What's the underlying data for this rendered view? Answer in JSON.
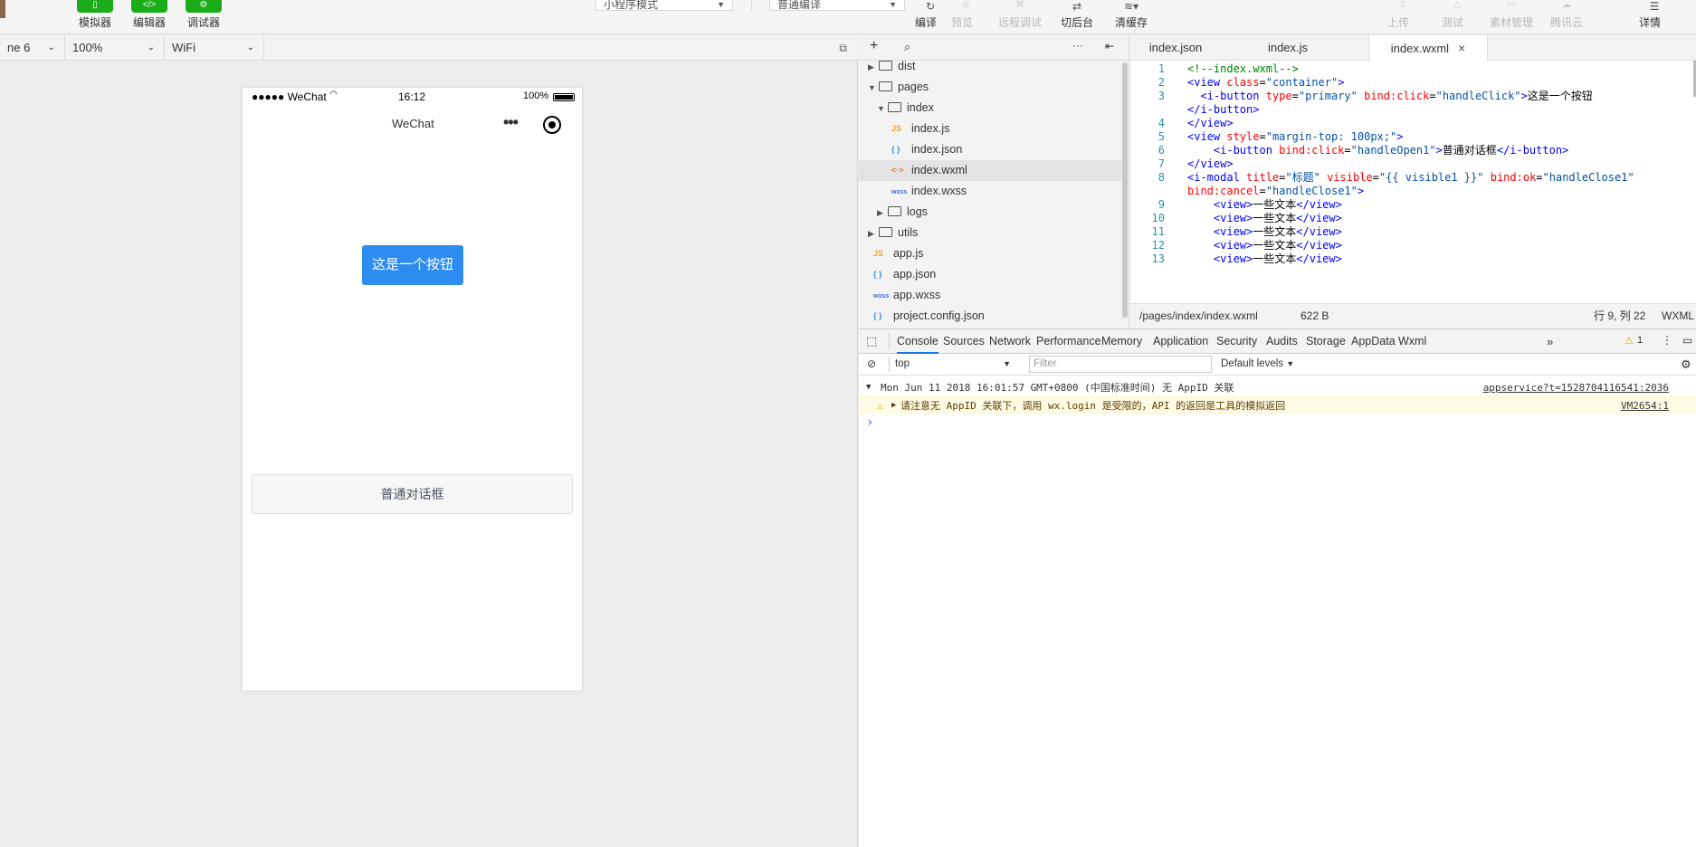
{
  "toolbar": {
    "simulator": "模拟器",
    "editor": "编辑器",
    "debugger": "调试器",
    "mode_select": "小程序模式",
    "compile_select": "普通编译",
    "compile": "编译",
    "preview": "预览",
    "remote_debug": "远程调试",
    "background": "切后台",
    "clear_cache": "清缓存",
    "upload": "上传",
    "test": "测试",
    "assets": "素材管理",
    "tencent_cloud": "腾讯云",
    "details": "详情"
  },
  "device_bar": {
    "device": "ne 6",
    "zoom": "100%",
    "network": "WiFi"
  },
  "phone": {
    "carrier": "●●●●● WeChat",
    "time": "16:12",
    "battery": "100%",
    "nav_title": "WeChat",
    "primary_button": "这是一个按钮",
    "dialog_button": "普通对话框"
  },
  "file_tree": [
    {
      "name": "dist",
      "type": "folder",
      "depth": 0,
      "open": false
    },
    {
      "name": "pages",
      "type": "folder",
      "depth": 0,
      "open": true
    },
    {
      "name": "index",
      "type": "folder",
      "depth": 1,
      "open": true
    },
    {
      "name": "index.js",
      "type": "js",
      "depth": 2
    },
    {
      "name": "index.json",
      "type": "json",
      "depth": 2
    },
    {
      "name": "index.wxml",
      "type": "wxml",
      "depth": 2,
      "selected": true
    },
    {
      "name": "index.wxss",
      "type": "wxss",
      "depth": 2
    },
    {
      "name": "logs",
      "type": "folder",
      "depth": 1,
      "open": false
    },
    {
      "name": "utils",
      "type": "folder",
      "depth": 0,
      "open": false
    },
    {
      "name": "app.js",
      "type": "js",
      "depth": 0
    },
    {
      "name": "app.json",
      "type": "json",
      "depth": 0
    },
    {
      "name": "app.wxss",
      "type": "wxss",
      "depth": 0
    },
    {
      "name": "project.config.json",
      "type": "json",
      "depth": 0
    }
  ],
  "icon_labels": {
    "js": "JS",
    "json": "{ }",
    "wxml": "<·>",
    "wxss": "wxss"
  },
  "editor": {
    "tabs": [
      "index.json",
      "index.js",
      "index.wxml"
    ],
    "active_tab": "index.wxml",
    "lines": [
      {
        "n": "1",
        "code": [
          [
            "cm",
            "<!--index.wxml-->"
          ]
        ]
      },
      {
        "n": "2",
        "code": [
          [
            "tg",
            "<view "
          ],
          [
            "at",
            "class"
          ],
          [
            "tx",
            "="
          ],
          [
            "st",
            "\"container\""
          ],
          [
            "tg",
            ">"
          ]
        ]
      },
      {
        "n": "3",
        "code": [
          [
            "tx",
            "  "
          ],
          [
            "tg",
            "<i-button "
          ],
          [
            "at",
            "type"
          ],
          [
            "tx",
            "="
          ],
          [
            "st",
            "\"primary\""
          ],
          [
            "tx",
            " "
          ],
          [
            "at",
            "bind:click"
          ],
          [
            "tx",
            "="
          ],
          [
            "st",
            "\"handleClick\""
          ],
          [
            "tg",
            ">"
          ],
          [
            "tx",
            "这是一个按钮"
          ]
        ]
      },
      {
        "n": "",
        "code": [
          [
            "tg",
            "</i-button>"
          ]
        ]
      },
      {
        "n": "4",
        "code": [
          [
            "tg",
            "</view>"
          ]
        ]
      },
      {
        "n": "5",
        "code": [
          [
            "tg",
            "<view "
          ],
          [
            "at",
            "style"
          ],
          [
            "tx",
            "="
          ],
          [
            "st",
            "\"margin-top: 100px;\""
          ],
          [
            "tg",
            ">"
          ]
        ]
      },
      {
        "n": "6",
        "code": [
          [
            "tx",
            "    "
          ],
          [
            "tg",
            "<i-button "
          ],
          [
            "at",
            "bind:click"
          ],
          [
            "tx",
            "="
          ],
          [
            "st",
            "\"handleOpen1\""
          ],
          [
            "tg",
            ">"
          ],
          [
            "tx",
            "普通对话框"
          ],
          [
            "tg",
            "</i-button>"
          ]
        ]
      },
      {
        "n": "7",
        "code": [
          [
            "tg",
            "</view>"
          ]
        ]
      },
      {
        "n": "8",
        "code": [
          [
            "tg",
            "<i-modal "
          ],
          [
            "at",
            "title"
          ],
          [
            "tx",
            "="
          ],
          [
            "st",
            "\"标题\""
          ],
          [
            "tx",
            " "
          ],
          [
            "at",
            "visible"
          ],
          [
            "tx",
            "="
          ],
          [
            "st",
            "\"{{ visible1 }}\""
          ],
          [
            "tx",
            " "
          ],
          [
            "at",
            "bind:ok"
          ],
          [
            "tx",
            "="
          ],
          [
            "st",
            "\"handleClose1\""
          ]
        ]
      },
      {
        "n": "",
        "code": [
          [
            "at",
            "bind:cancel"
          ],
          [
            "tx",
            "="
          ],
          [
            "st",
            "\"handleClose1\""
          ],
          [
            "tg",
            ">"
          ]
        ]
      },
      {
        "n": "9",
        "code": [
          [
            "tx",
            "    "
          ],
          [
            "tg",
            "<view>"
          ],
          [
            "tx",
            "一些文本"
          ],
          [
            "tg",
            "</view>"
          ]
        ]
      },
      {
        "n": "10",
        "code": [
          [
            "tx",
            "    "
          ],
          [
            "tg",
            "<view>"
          ],
          [
            "tx",
            "一些文本"
          ],
          [
            "tg",
            "</view>"
          ]
        ]
      },
      {
        "n": "11",
        "code": [
          [
            "tx",
            "    "
          ],
          [
            "tg",
            "<view>"
          ],
          [
            "tx",
            "一些文本"
          ],
          [
            "tg",
            "</view>"
          ]
        ]
      },
      {
        "n": "12",
        "code": [
          [
            "tx",
            "    "
          ],
          [
            "tg",
            "<view>"
          ],
          [
            "tx",
            "一些文本"
          ],
          [
            "tg",
            "</view>"
          ]
        ]
      },
      {
        "n": "13",
        "code": [
          [
            "tx",
            "    "
          ],
          [
            "tg",
            "<view>"
          ],
          [
            "tx",
            "一些文本"
          ],
          [
            "tg",
            "</view>"
          ]
        ]
      }
    ],
    "status_path": "/pages/index/index.wxml",
    "status_size": "622 B",
    "status_pos": "行 9, 列 22",
    "status_lang": "WXML"
  },
  "devtools": {
    "tabs": [
      "Console",
      "Sources",
      "Network",
      "Performance",
      "Memory",
      "Application",
      "Security",
      "Audits",
      "Storage",
      "AppData",
      "Wxml"
    ],
    "more": "»",
    "warn_count": "1",
    "context": "top",
    "filter_placeholder": "Filter",
    "levels": "Default levels",
    "log_header": "Mon Jun 11 2018 16:01:57 GMT+0800 (中国标准时间) 无 AppID 关联",
    "log_header_src": "appservice?t=1528704116541:2036",
    "warn_text": "请注意无 AppID 关联下，调用 wx.login 是受限的，API 的返回是工具的模拟返回",
    "warn_src": "VM2654:1",
    "prompt": "›"
  }
}
